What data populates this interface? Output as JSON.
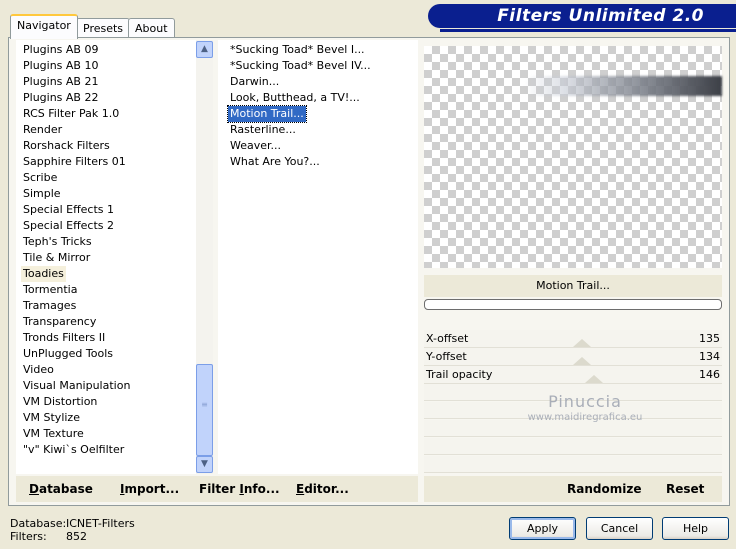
{
  "tabs": [
    {
      "label": "Navigator"
    },
    {
      "label": "Presets"
    },
    {
      "label": "About"
    }
  ],
  "banner": {
    "title": "Filters Unlimited 2.0",
    "color": "#0a1f8f"
  },
  "categories": [
    "Plugins AB 09",
    "Plugins AB 10",
    "Plugins AB 21",
    "Plugins AB 22",
    "RCS Filter Pak 1.0",
    "Render",
    "Rorshack Filters",
    "Sapphire Filters 01",
    "Scribe",
    "Simple",
    "Special Effects 1",
    "Special Effects 2",
    "Teph's Tricks",
    "Tile & Mirror",
    "Toadies",
    "Tormentia",
    "Tramages",
    "Transparency",
    "Tronds Filters II",
    "UnPlugged Tools",
    "Video",
    "Visual Manipulation",
    "VM Distortion",
    "VM Stylize",
    "VM Texture",
    "\"v\" Kiwi`s Oelfilter"
  ],
  "selected_category": "Toadies",
  "filters": [
    "*Sucking Toad*  Bevel I...",
    "*Sucking Toad*  Bevel IV...",
    "Darwin...",
    "Look, Butthead, a TV!...",
    "Motion Trail...",
    "Rasterline...",
    "Weaver...",
    "What Are You?..."
  ],
  "selected_filter": "Motion Trail...",
  "preview": {
    "filter_name": "Motion Trail...",
    "progress": 0
  },
  "params": [
    {
      "label": "X-offset",
      "value": "135",
      "level": 0.53
    },
    {
      "label": "Y-offset",
      "value": "134",
      "level": 0.53
    },
    {
      "label": "Trail opacity",
      "value": "146",
      "level": 0.57
    }
  ],
  "watermark": {
    "name": "Pinuccia",
    "url": "www.maidiregrafica.eu"
  },
  "bottom_left": {
    "database": {
      "prefix": "",
      "ul": "D",
      "rest": "atabase"
    },
    "import": {
      "prefix": "",
      "ul": "I",
      "rest": "mport..."
    },
    "filter_info": {
      "prefix": "Filter ",
      "ul": "I",
      "rest": "nfo..."
    },
    "editor": {
      "prefix": "",
      "ul": "E",
      "rest": "ditor..."
    }
  },
  "bottom_right": {
    "randomize": "Randomize",
    "reset": "Reset"
  },
  "footer": {
    "database_label": "Database:",
    "database_value": "ICNET-Filters",
    "filters_label": "Filters:",
    "filters_value": "852"
  },
  "buttons": {
    "apply": "Apply",
    "cancel": "Cancel",
    "help": "Help"
  },
  "icons": {
    "scroll_up": "▲",
    "scroll_down": "▼"
  }
}
